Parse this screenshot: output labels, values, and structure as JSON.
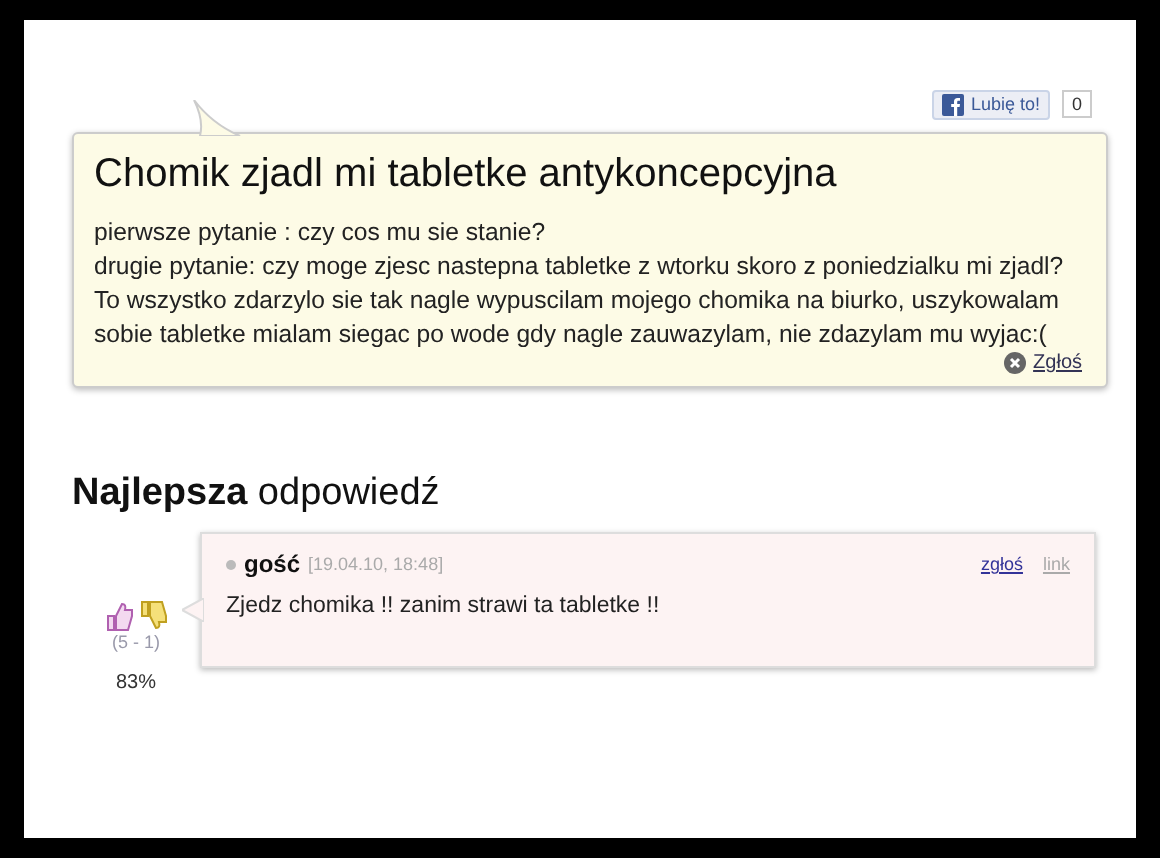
{
  "like": {
    "label": "Lubię to!",
    "count": "0"
  },
  "question": {
    "title": "Chomik zjadl mi tabletke antykoncepcyjna",
    "paragraphs": [
      "pierwsze pytanie : czy cos mu sie stanie?",
      "drugie pytanie: czy moge zjesc nastepna tabletke z wtorku skoro z poniedzialku mi zjadl?",
      "To wszystko zdarzylo sie tak nagle wypuscilam mojego chomika na biurko, uszykowalam sobie tabletke mialam siegac po wode gdy nagle zauwazylam, nie zdazylam mu wyjac:("
    ],
    "report": "Zgłoś"
  },
  "best_answer": {
    "heading": "**Najlepsza** odpowiedź",
    "votes": "(5 - 1)",
    "percent": "83%",
    "author": "gość",
    "date": "[19.04.10, 18:48]",
    "report": "zgłoś",
    "link": "link",
    "text": "Zjedz chomika !! zanim strawi ta tabletke !!"
  }
}
